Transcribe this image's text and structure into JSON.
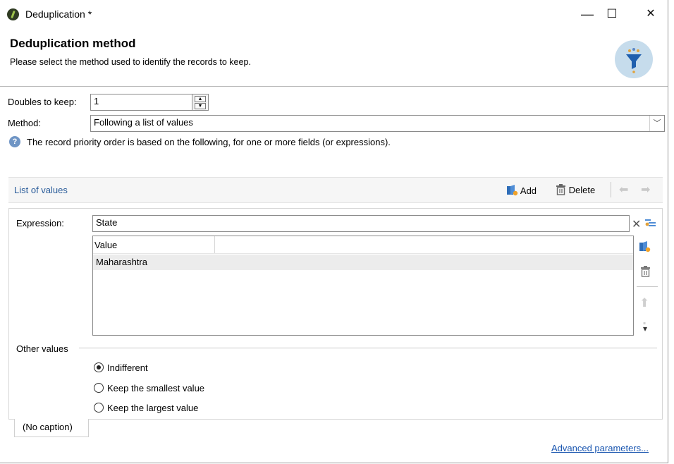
{
  "window": {
    "title": "Deduplication *",
    "controls": {
      "minimize": "—",
      "maximize": "☐",
      "close": "✕"
    }
  },
  "header": {
    "title": "Deduplication method",
    "subtitle": "Please select the method used to identify the records to keep.",
    "icon": "funnel-dedup-icon"
  },
  "form": {
    "doubles_label": "Doubles to keep:",
    "doubles_value": "1",
    "method_label": "Method:",
    "method_value": "Following a list of values",
    "info_text": "The record priority order is based on the following, for one or more fields (or expressions)."
  },
  "list_section": {
    "title": "List of values",
    "add_label": "Add",
    "delete_label": "Delete"
  },
  "expression": {
    "label": "Expression:",
    "value": "State"
  },
  "values_table": {
    "column": "Value",
    "rows": [
      "Maharashtra"
    ]
  },
  "other_values": {
    "label": "Other values",
    "options": [
      "Indifferent",
      "Keep the smallest value",
      "Keep the largest value"
    ],
    "selected": "Indifferent"
  },
  "tab_caption": "(No caption)",
  "advanced_link": "Advanced parameters..."
}
